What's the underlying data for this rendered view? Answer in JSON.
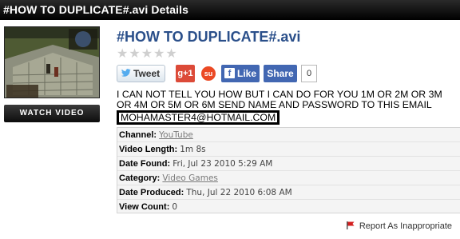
{
  "header": {
    "title": "#HOW TO DUPLICATE#.avi Details"
  },
  "video": {
    "title": "#HOW TO DUPLICATE#.avi",
    "watch_label": "WATCH VIDEO",
    "rating_stars": 0,
    "rating_max": 5
  },
  "share": {
    "tweet_label": "Tweet",
    "gplus_label": "g+1",
    "stumble_label": "su",
    "like_label": "Like",
    "share_label": "Share",
    "share_count": "0"
  },
  "description": {
    "text": "I CAN NOT TELL YOU HOW BUT I CAN DO FOR YOU 1M OR 2M OR 3M OR 4M OR 5M OR 6M SEND NAME AND PASSWORD TO THIS EMAIL ",
    "email": "MOHAMASTER4@HOTMAIL.COM"
  },
  "details": {
    "channel_label": "Channel:",
    "channel_value": "YouTube",
    "length_label": "Video Length:",
    "length_value": "1m 8s",
    "found_label": "Date Found:",
    "found_value": "Fri, Jul 23 2010 5:29 AM",
    "category_label": "Category:",
    "category_value": "Video Games",
    "produced_label": "Date Produced:",
    "produced_value": "Thu, Jul 22 2010 6:08 AM",
    "views_label": "View Count:",
    "views_value": "0"
  },
  "report": {
    "label": "Report As Inappropriate"
  },
  "colors": {
    "header_bg": "#000000",
    "title_blue": "#2a4f8a",
    "facebook_blue": "#4267b2",
    "gplus_red": "#dc4a38",
    "stumble_orange": "#eb4924",
    "star_grey": "#cfcfcf"
  }
}
